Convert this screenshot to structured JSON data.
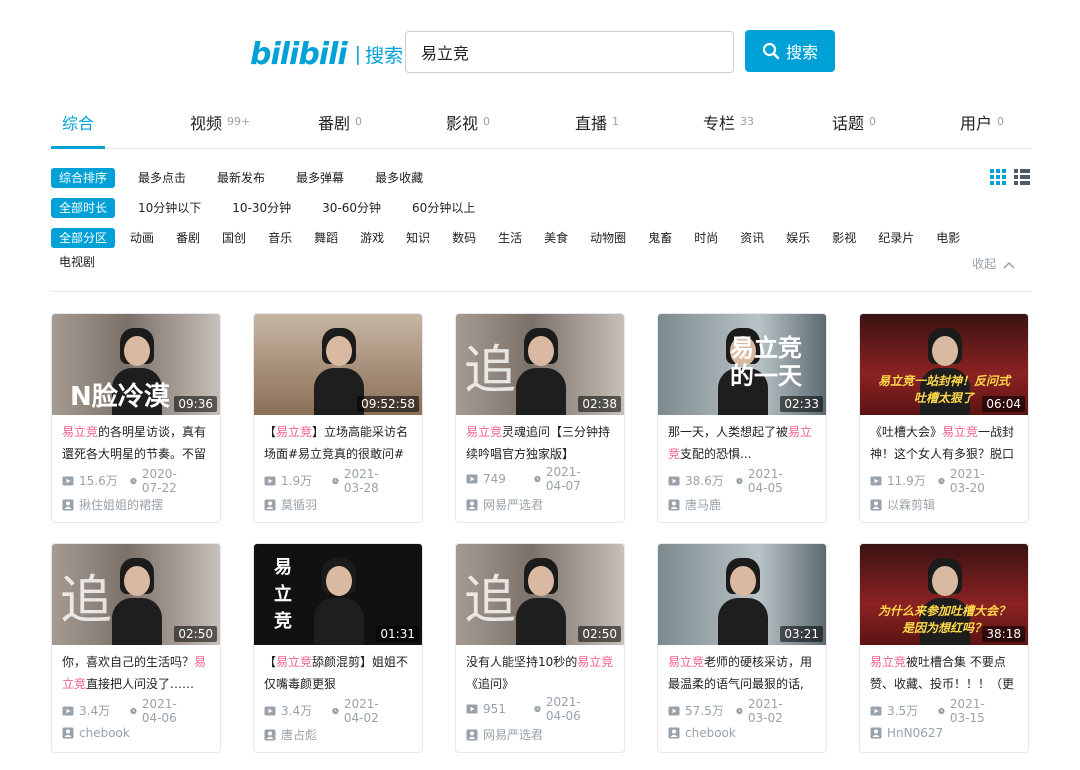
{
  "header": {
    "logo_text": "bilibili",
    "logo_sep": "|",
    "logo_sub": "搜索",
    "search_value": "易立竞",
    "search_button": "搜索"
  },
  "tabs": [
    {
      "label": "综合",
      "count": ""
    },
    {
      "label": "视频",
      "count": "99+"
    },
    {
      "label": "番剧",
      "count": "0"
    },
    {
      "label": "影视",
      "count": "0"
    },
    {
      "label": "直播",
      "count": "1"
    },
    {
      "label": "专栏",
      "count": "33"
    },
    {
      "label": "话题",
      "count": "0"
    },
    {
      "label": "用户",
      "count": "0"
    }
  ],
  "filters": {
    "sort": [
      "综合排序",
      "最多点击",
      "最新发布",
      "最多弹幕",
      "最多收藏"
    ],
    "duration": [
      "全部时长",
      "10分钟以下",
      "10-30分钟",
      "30-60分钟",
      "60分钟以上"
    ],
    "zones": [
      "全部分区",
      "动画",
      "番剧",
      "国创",
      "音乐",
      "舞蹈",
      "游戏",
      "知识",
      "数码",
      "生活",
      "美食",
      "动物圈",
      "鬼畜",
      "时尚",
      "资讯",
      "娱乐",
      "影视",
      "纪录片",
      "电影"
    ],
    "zones_row2": [
      "电视剧"
    ],
    "collapse": "收起"
  },
  "videos": [
    {
      "pre": "",
      "hl": "易立竞",
      "post": "的各明星访谈，真有 還死各大明星的节奏。不留",
      "duration": "09:36",
      "views": "15.6万",
      "date": "2020-07-22",
      "author": "揪住姐姐的裙摆",
      "overlay": "N脸冷漠"
    },
    {
      "pre": "【",
      "hl": "易立竞",
      "post": "】立场高能采访名 场面#易立竞真的很敢问#立",
      "duration": "09:52:58",
      "views": "1.9万",
      "date": "2021-03-28",
      "author": "莫循羽",
      "overlay": ""
    },
    {
      "pre": "",
      "hl": "易立竞",
      "post": "灵魂追问【三分钟持 续吟唱官方独家版】",
      "duration": "02:38",
      "views": "749",
      "date": "2021-04-07",
      "author": "网易严选君",
      "overlay": "追 问"
    },
    {
      "pre": "那一天，人类想起了被",
      "hl": "易立竞",
      "post": "支配的恐惧...",
      "duration": "02:33",
      "views": "38.6万",
      "date": "2021-04-05",
      "author": "唐马鹿",
      "overlay": "易立竞 的一天"
    },
    {
      "pre": "《吐槽大会》",
      "hl": "易立竞",
      "post": "一战封 神！这个女人有多狠？脱口",
      "duration": "06:04",
      "views": "11.9万",
      "date": "2021-03-20",
      "author": "以霖剪辑",
      "overlay": "易立竞一站封神！反问式 吐槽太狠了"
    },
    {
      "pre": "你，喜欢自己的生活吗？",
      "hl": "易立竞",
      "post": "直接把人问没了……",
      "duration": "02:50",
      "views": "3.4万",
      "date": "2021-04-06",
      "author": "chebook",
      "overlay": "追 问"
    },
    {
      "pre": "【",
      "hl": "易立竞",
      "post": "舔颜混剪】姐姐不 仅嘴毒颜更狠",
      "duration": "01:31",
      "views": "3.4万",
      "date": "2021-04-02",
      "author": "唐占彪",
      "overlay": "易 立 竞"
    },
    {
      "pre": "没有人能坚持10秒的",
      "hl": "易立竞",
      "post": "《追问》",
      "duration": "02:50",
      "views": "951",
      "date": "2021-04-06",
      "author": "网易严选君",
      "overlay": "追 问"
    },
    {
      "pre": "",
      "hl": "易立竞",
      "post": "老师的硬核采访，用 最温柔的语气问最狠的话,",
      "duration": "03:21",
      "views": "57.5万",
      "date": "2021-03-02",
      "author": "chebook",
      "overlay": ""
    },
    {
      "pre": "",
      "hl": "易立竞",
      "post": "被吐槽合集 不要点 赞、收藏、投币！！！（更",
      "duration": "38:18",
      "views": "3.5万",
      "date": "2021-03-15",
      "author": "HnN0627",
      "overlay": "为什么来参加吐槽大会？ 是因为想红吗？"
    }
  ],
  "colors": {
    "accent": "#00a1d6",
    "highlight": "#f25d8e",
    "muted": "#99a2aa"
  }
}
